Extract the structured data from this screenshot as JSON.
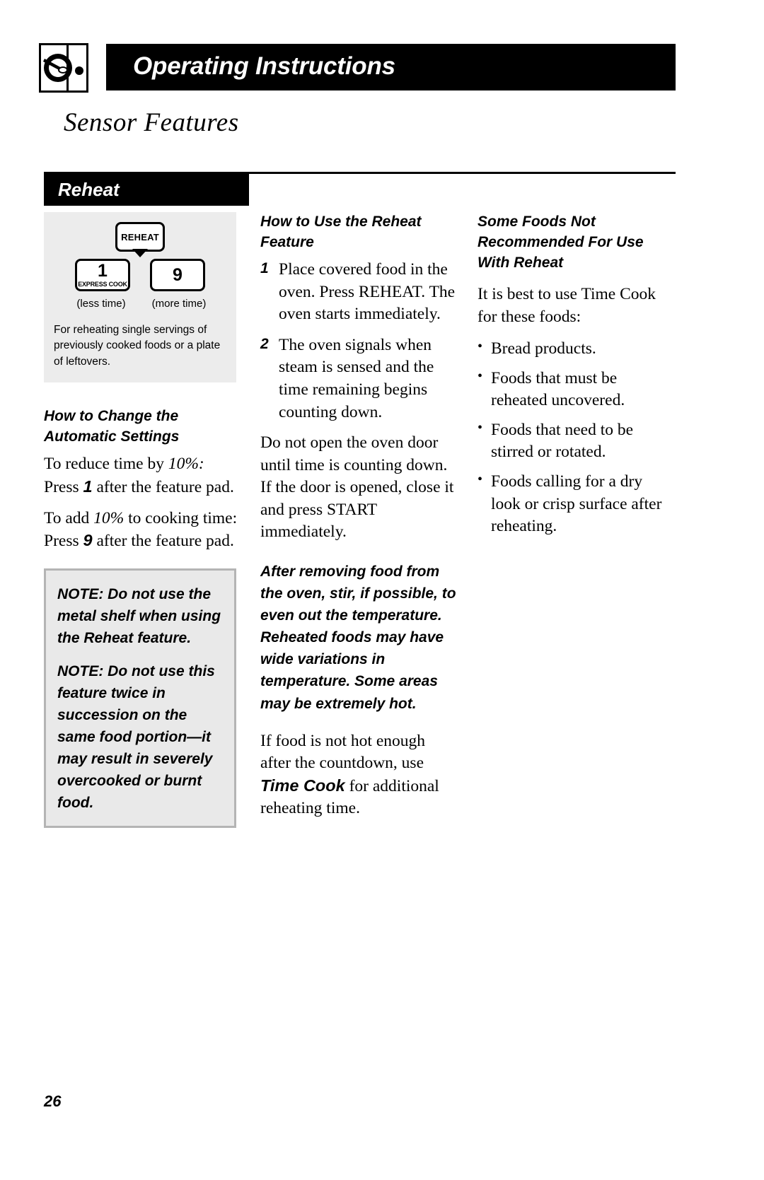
{
  "header": {
    "title": "Operating Instructions",
    "icon": "microwave-oven-icon"
  },
  "section_title": "Sensor Features",
  "feature_label": "Reheat",
  "control_panel": {
    "reheat_key": "REHEAT",
    "less_key_number": "1",
    "less_key_sub": "EXPRESS COOK",
    "more_key_number": "9",
    "less_caption": "(less time)",
    "more_caption": "(more time)",
    "description": "For reheating single servings of previously cooked foods or a plate of leftovers."
  },
  "left_column": {
    "heading": "How to Change the Automatic Settings",
    "para1_pre": "To reduce time by ",
    "para1_em": "10%:",
    "para1_mid": " Press ",
    "para1_bold": "1",
    "para1_post": " after the feature pad.",
    "para2_pre": "To add ",
    "para2_em": "10%",
    "para2_mid": " to cooking time: Press ",
    "para2_bold": "9",
    "para2_post": " after the feature pad.",
    "note1": "NOTE: Do not use the metal shelf when using the Reheat feature.",
    "note2": "NOTE: Do not use this feature twice in succession on the same food portion—it may result in severely overcooked or burnt food."
  },
  "middle_column": {
    "heading": "How to Use the Reheat Feature",
    "steps": [
      {
        "num": "1",
        "text": "Place covered food in the oven. Press REHEAT. The oven starts immediately."
      },
      {
        "num": "2",
        "text": "The oven signals when steam is sensed and the time remaining begins counting down."
      }
    ],
    "para1": "Do not open the oven door until time is counting down. If the door is opened, close it and press START immediately.",
    "emphasis_para": "After removing food from the oven, stir, if possible, to even out the temperature. Reheated foods may have wide variations in temperature. Some areas may be extremely hot.",
    "para2_pre": "If food is not hot enough after the countdown, use ",
    "para2_bold": "Time Cook",
    "para2_post": " for additional reheating time."
  },
  "right_column": {
    "heading": "Some Foods Not Recommended For Use With Reheat",
    "intro": "It is best to use Time Cook for these foods:",
    "bullets": [
      "Bread products.",
      "Foods that must be reheated uncovered.",
      "Foods that need to be stirred or rotated.",
      "Foods calling for a dry look or crisp surface after reheating."
    ]
  },
  "page_number": "26",
  "colors": {
    "bar": "#000000",
    "panel_bg": "#ececec",
    "note_bg": "#e9e9e9",
    "note_border": "#b4b4b4"
  }
}
